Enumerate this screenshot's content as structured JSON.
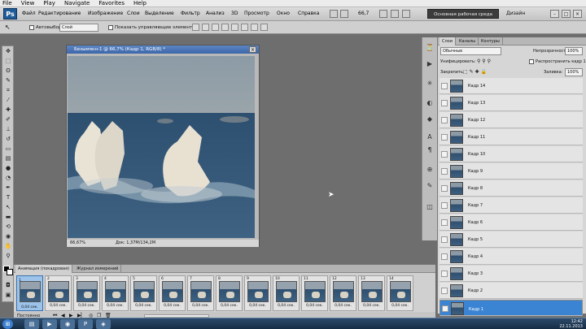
{
  "player_menu": {
    "items": [
      "File",
      "View",
      "Play",
      "Navigate",
      "Favorites",
      "Help"
    ]
  },
  "ps": {
    "logo": "Ps",
    "menu": [
      "Файл",
      "Редактирование",
      "Изображение",
      "Слои",
      "Выделение",
      "Фильтр",
      "Анализ",
      "3D",
      "Просмотр",
      "Окно",
      "Справка"
    ],
    "zoom": "66,7",
    "workspace": "Основная рабочая среда",
    "design": "Дизайн",
    "win_min": "–",
    "win_max": "□",
    "win_close": "×"
  },
  "options": {
    "autoselect_label": "Автовыбор:",
    "autoselect_value": "Слой",
    "show_controls_label": "Показать управляющие элементы"
  },
  "document": {
    "title": "Безымянн-1 @ 66,7% (Кадр 1, RGB/8) *",
    "close": "×",
    "status_zoom": "66,67%",
    "status_doc": "Док: 1,37M/134,2M"
  },
  "layers_panel": {
    "tabs": [
      "Слои",
      "Каналы",
      "Контуры"
    ],
    "blend_mode": "Обычные",
    "opacity_label": "Непрозрачность:",
    "opacity_value": "100%",
    "unify_label": "Унифицировать:",
    "propagate_label": "Распространить кадр 1",
    "lock_label": "Закрепить:",
    "fill_label": "Заливка:",
    "fill_value": "100%",
    "layers": [
      "Кадр 14",
      "Кадр 13",
      "Кадр 12",
      "Кадр 11",
      "Кадр 10",
      "Кадр 9",
      "Кадр 8",
      "Кадр 7",
      "Кадр 6",
      "Кадр 5",
      "Кадр 4",
      "Кадр 3",
      "Кадр 2",
      "Кадр 1"
    ],
    "selected_layer": "Кадр 1"
  },
  "animation_panel": {
    "tabs": [
      "Анимация (покадровая)",
      "Журнал измерений"
    ],
    "frames": [
      {
        "num": "1",
        "delay": "0,04 сек."
      },
      {
        "num": "2",
        "delay": "0,04 сек."
      },
      {
        "num": "3",
        "delay": "0,04 сек."
      },
      {
        "num": "4",
        "delay": "0,04 сек."
      },
      {
        "num": "5",
        "delay": "0,04 сек."
      },
      {
        "num": "6",
        "delay": "0,04 сек."
      },
      {
        "num": "7",
        "delay": "0,04 сек."
      },
      {
        "num": "8",
        "delay": "0,04 сек."
      },
      {
        "num": "9",
        "delay": "0,04 сек."
      },
      {
        "num": "10",
        "delay": "0,04 сек."
      },
      {
        "num": "11",
        "delay": "0,04 сек."
      },
      {
        "num": "12",
        "delay": "0,04 сек."
      },
      {
        "num": "13",
        "delay": "0,04 сек."
      },
      {
        "num": "14",
        "delay": "0,04 сек."
      }
    ],
    "loop": "Постоянно"
  },
  "taskbar": {
    "time": "12:42",
    "date": "22.11.2013"
  },
  "colors": {
    "accent": "#3a84d3",
    "title_bar": "#3b66a8",
    "taskbar": "#1d3550"
  }
}
